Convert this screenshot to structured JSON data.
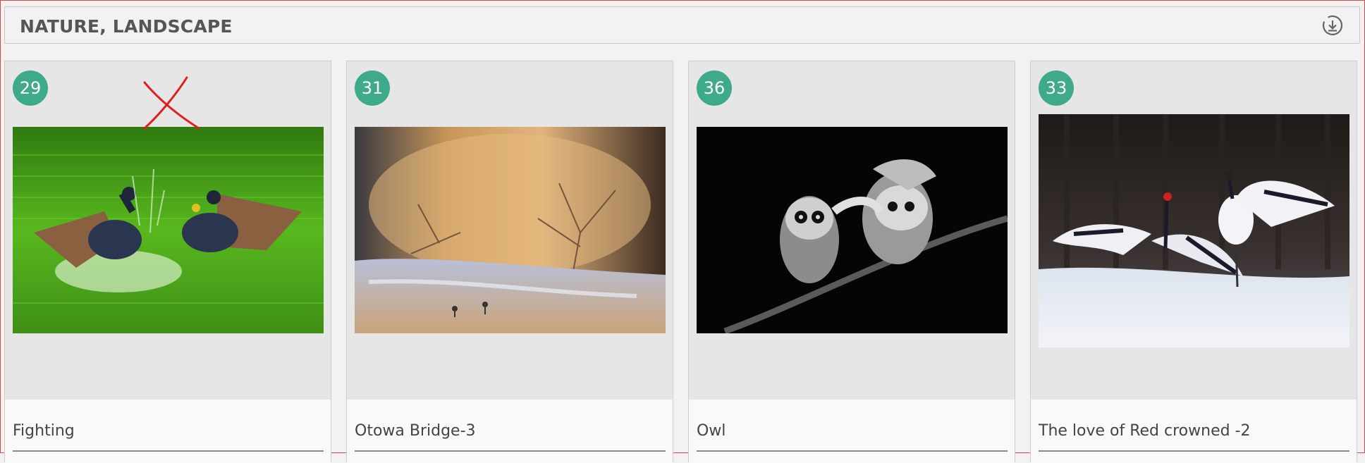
{
  "header": {
    "title": "NATURE, LANDSCAPE",
    "download_icon": "download-circle-icon"
  },
  "cards": [
    {
      "number": "29",
      "title": "Fighting",
      "photo": "birds-fighting-on-green-water"
    },
    {
      "number": "31",
      "title": "Otowa Bridge-3",
      "photo": "frosted-trees-by-river"
    },
    {
      "number": "36",
      "title": "Owl",
      "photo": "two-owls-on-branch-bw"
    },
    {
      "number": "33",
      "title": "The love of Red crowned -2",
      "photo": "red-crowned-cranes-in-snow"
    }
  ],
  "colors": {
    "badge": "#3fa98c",
    "annotation": "#e02020",
    "frame": "#d04850"
  }
}
